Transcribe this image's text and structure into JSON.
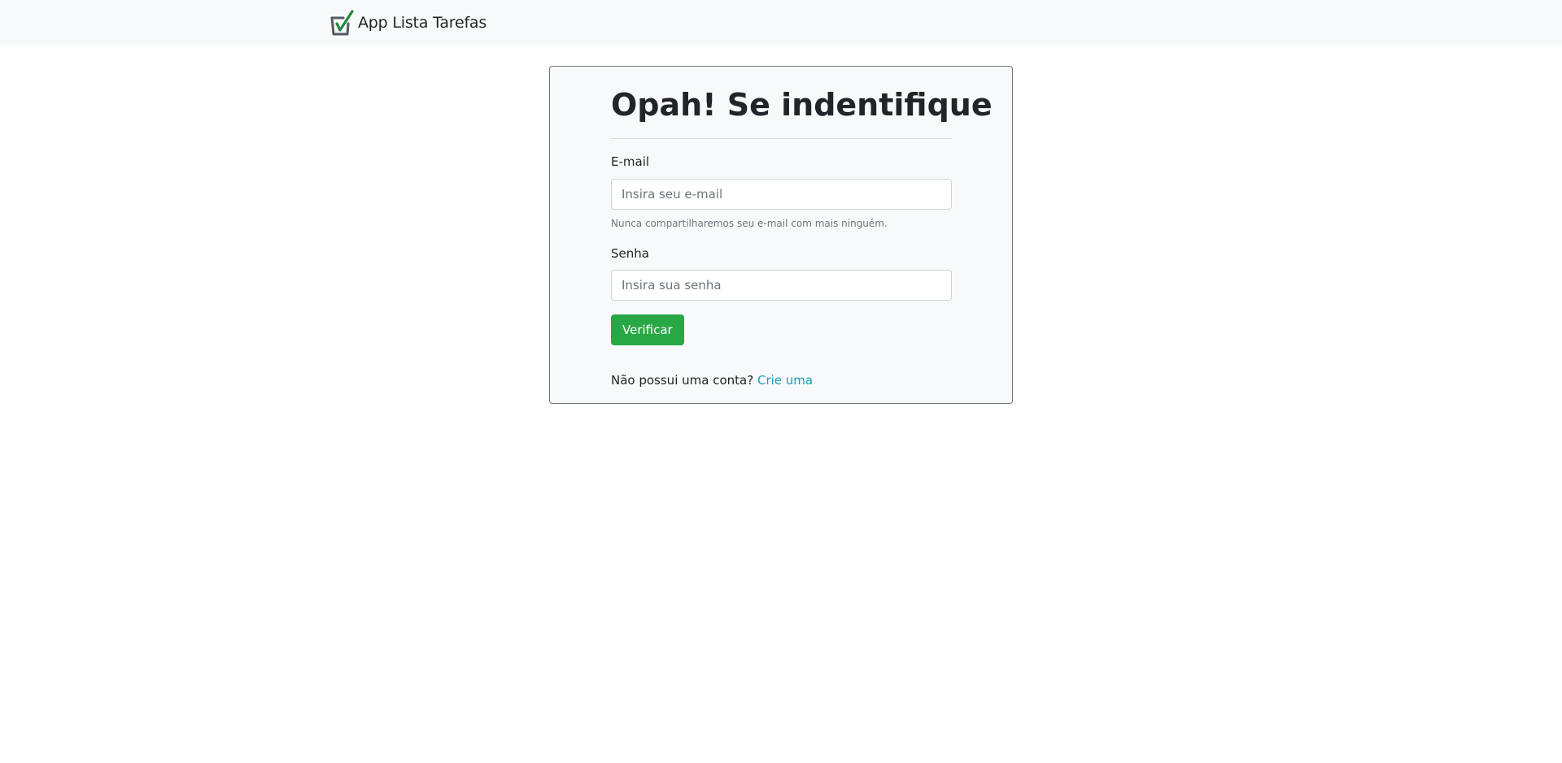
{
  "navbar": {
    "brand_text": "App Lista Tarefas",
    "brand_icon": "checkbox-check-icon"
  },
  "login": {
    "title": "Opah! Se indentifique",
    "email_label": "E-mail",
    "email_placeholder": "Insira seu e-mail",
    "email_help": "Nunca compartilharemos seu e-mail com mais ninguém.",
    "password_label": "Senha",
    "password_placeholder": "Insira sua senha",
    "submit_label": "Verificar",
    "signup_prompt": "Não possui uma conta?",
    "signup_link": "Crie uma"
  },
  "colors": {
    "navbar_bg": "#f8f9fa",
    "card_bg": "#f8f9fa",
    "button_bg": "#28a745",
    "link": "#17a2b8",
    "check_green": "#28a745"
  }
}
